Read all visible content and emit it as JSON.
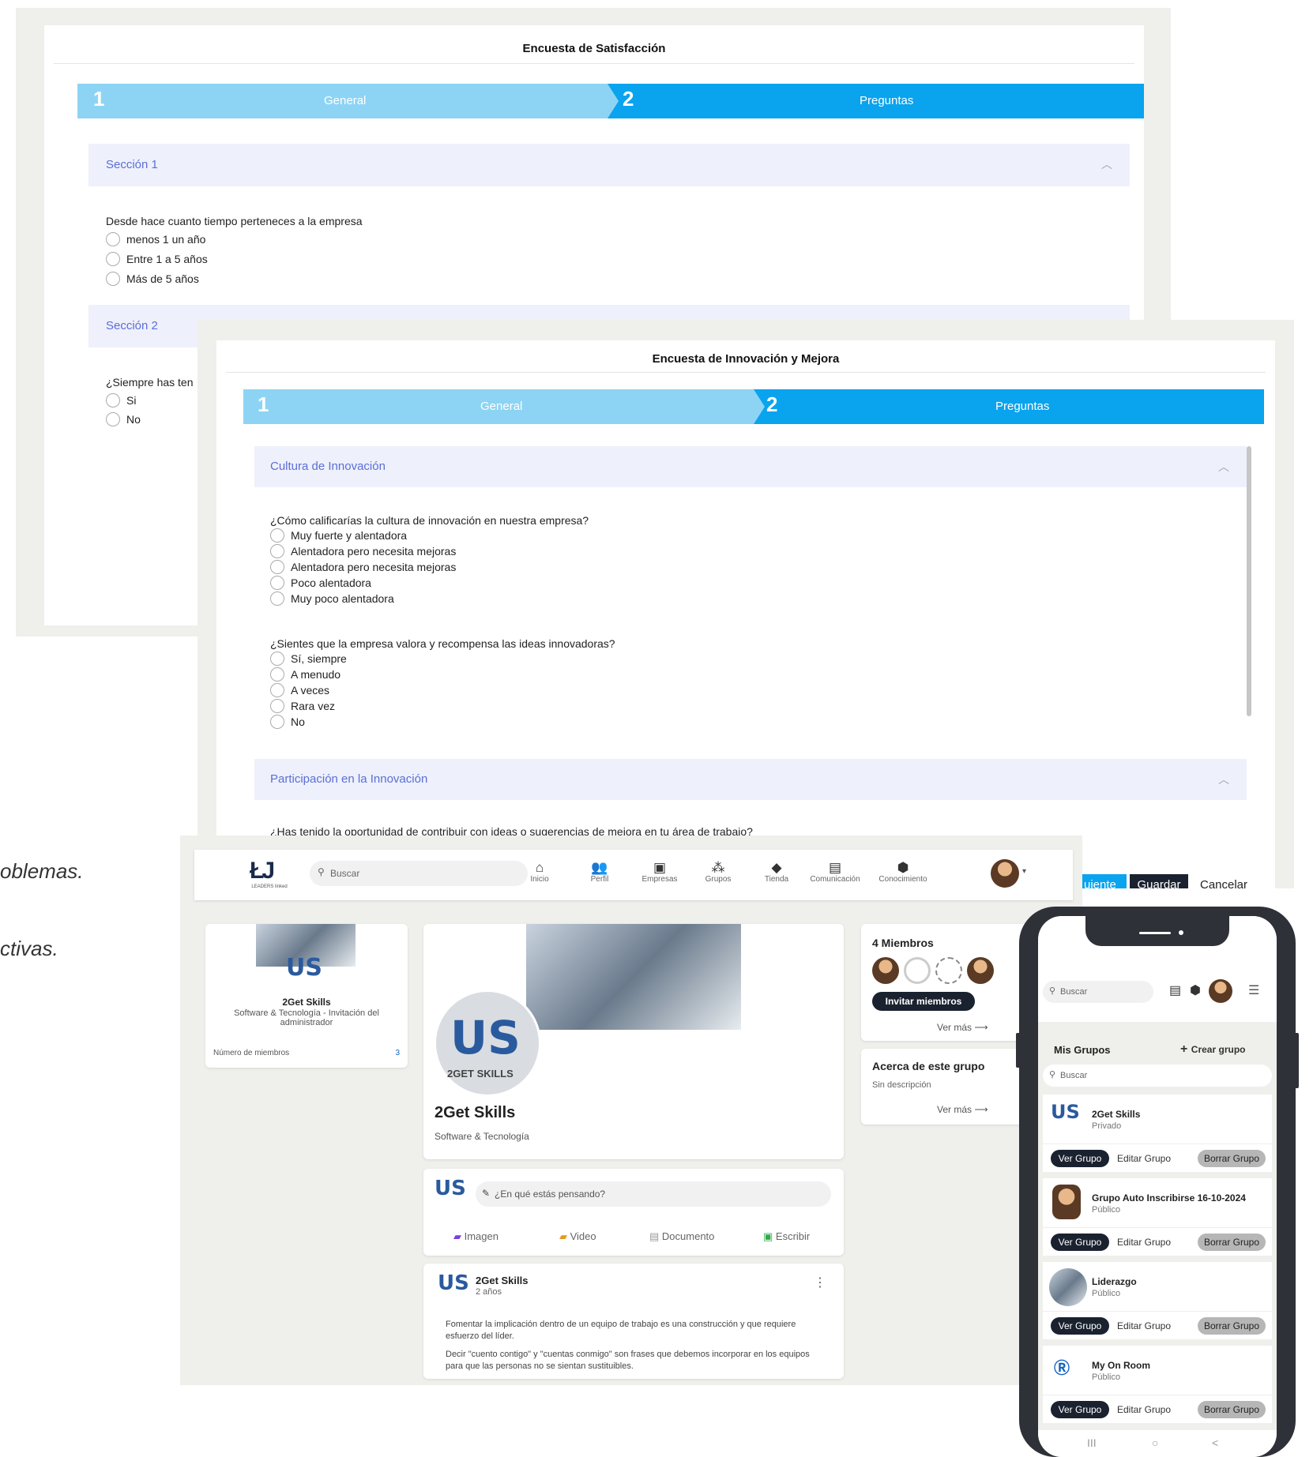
{
  "bg_text": {
    "line1": "oblemas.",
    "line2": "ctivas."
  },
  "survey1": {
    "title": "Encuesta de Satisfacción",
    "steps": [
      {
        "num": "1",
        "label": "General"
      },
      {
        "num": "2",
        "label": "Preguntas"
      }
    ],
    "section1": {
      "title": "Sección 1",
      "question": "Desde hace cuanto tiempo perteneces a la empresa",
      "options": [
        "menos 1 un año",
        "Entre 1 a 5 años",
        "Más de 5 años"
      ]
    },
    "section2": {
      "title": "Sección 2",
      "question": "¿Siempre has ten",
      "options": [
        "Si",
        "No"
      ]
    }
  },
  "survey2": {
    "title": "Encuesta de Innovación y Mejora",
    "steps": [
      {
        "num": "1",
        "label": "General"
      },
      {
        "num": "2",
        "label": "Preguntas"
      }
    ],
    "section1": {
      "title": "Cultura de Innovación",
      "q1": "¿Cómo calificarías la cultura de innovación en nuestra empresa?",
      "q1_options": [
        "Muy fuerte y alentadora",
        "Alentadora pero necesita mejoras",
        "Alentadora pero necesita mejoras",
        "Poco alentadora",
        "Muy poco alentadora"
      ],
      "q2": "¿Sientes que la empresa valora y recompensa las ideas innovadoras?",
      "q2_options": [
        "Sí, siempre",
        "A menudo",
        "A veces",
        "Rara vez",
        "No"
      ]
    },
    "section2": {
      "title": "Participación en la Innovación",
      "q1": "¿Has tenido la oportunidad de contribuir con ideas o sugerencias de mejora en tu área de trabajo?"
    },
    "buttons": {
      "next": "uiente",
      "save": "Guardar",
      "cancel": "Cancelar"
    }
  },
  "social": {
    "logo_sub": "LEADERS linked",
    "search_placeholder": "Buscar",
    "nav": [
      {
        "label": "Inicio",
        "icon": "home-icon"
      },
      {
        "label": "Perfil",
        "icon": "people-icon"
      },
      {
        "label": "Empresas",
        "icon": "briefcase-icon"
      },
      {
        "label": "Grupos",
        "icon": "group-icon"
      },
      {
        "label": "Tienda",
        "icon": "tag-icon"
      },
      {
        "label": "Comunicación",
        "icon": "chat-icon"
      },
      {
        "label": "Conocimiento",
        "icon": "graduation-cap-icon"
      }
    ],
    "left_card": {
      "name": "2Get Skills",
      "desc": "Software & Tecnología - Invitación del administrador",
      "members_label": "Número de miembros",
      "members_count": "3"
    },
    "group": {
      "name": "2Get Skills",
      "category": "Software & Tecnología",
      "logo_text": "2GET SKILLS"
    },
    "composer": {
      "placeholder": "¿En qué estás pensando?",
      "actions": [
        "Imagen",
        "Video",
        "Documento",
        "Escribir"
      ]
    },
    "post": {
      "author": "2Get Skills",
      "time": "2 años",
      "p1": "Fomentar la implicación dentro de un equipo de trabajo es una construcción y que requiere esfuerzo del líder.",
      "p2": "Decir \"cuento contigo\" y \"cuentas conmigo\" son frases que debemos incorporar en los equipos para que las personas no se sientan sustituibles."
    },
    "members": {
      "title": "4 Miembros",
      "invite": "Invitar miembros",
      "more": "Ver más"
    },
    "about": {
      "title": "Acerca de este grupo",
      "desc": "Sin descripción",
      "more": "Ver más"
    }
  },
  "phone": {
    "search_placeholder": "Buscar",
    "my_groups": "Mis Grupos",
    "create_group": "Crear grupo",
    "list_search": "Buscar",
    "groups": [
      {
        "name": "2Get Skills",
        "visibility": "Privado"
      },
      {
        "name": "Grupo Auto Inscribirse 16-10-2024",
        "visibility": "Público"
      },
      {
        "name": "Liderazgo",
        "visibility": "Público"
      },
      {
        "name": "My On Room",
        "visibility": "Público"
      }
    ],
    "btn_view": "Ver Grupo",
    "btn_edit": "Editar Grupo",
    "btn_delete": "Borrar Grupo",
    "nav": [
      "III",
      "○",
      "<"
    ]
  },
  "colors": {
    "step1": "#8dd4f4",
    "step2": "#0aa3ee",
    "section_head": "#eef0fb",
    "section_text": "#5b6fd6",
    "dark_button": "#1a2230"
  }
}
